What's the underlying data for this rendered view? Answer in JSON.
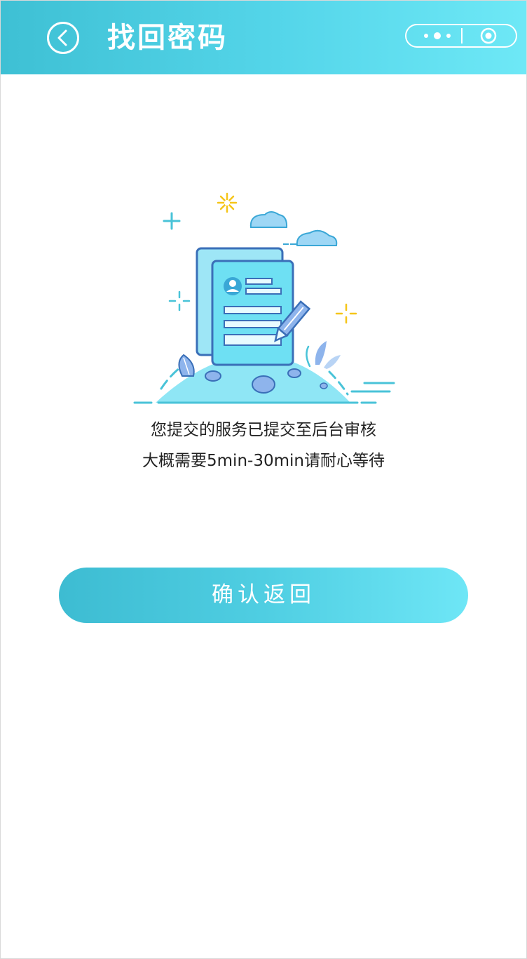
{
  "header": {
    "title": "找回密码"
  },
  "message": {
    "line1": "您提交的服务已提交至后台审核",
    "line2": "大概需要5min-30min请耐心等待"
  },
  "confirm_button": {
    "label": "确认返回"
  },
  "colors": {
    "header_start": "#3ec0d4",
    "header_end": "#6ee8f6",
    "button_start": "#3dbcd2",
    "button_end": "#6ee6f6",
    "accent_yellow": "#f5c518",
    "doc_blue": "#3a6fb8"
  },
  "icons": {
    "back": "chevron-left-icon",
    "more": "more-dots-icon",
    "close": "target-circle-icon",
    "illustration": "document-submitted-illustration"
  }
}
